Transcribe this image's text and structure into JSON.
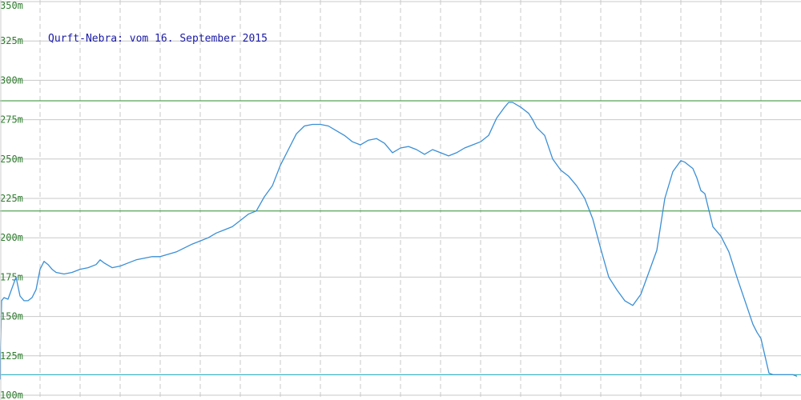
{
  "chart_data": {
    "type": "line",
    "title": "Qurft-Nebra: vom 16. September 2015",
    "ylim": [
      100,
      350
    ],
    "yticks": [
      "100m",
      "125m",
      "150m",
      "175m",
      "200m",
      "225m",
      "250m",
      "275m",
      "300m",
      "325m",
      "350m"
    ],
    "ytick_values": [
      100,
      125,
      150,
      175,
      200,
      225,
      250,
      275,
      300,
      325,
      350
    ],
    "xlim": [
      0,
      100
    ],
    "x_gridlines": [
      5,
      10,
      15,
      20,
      25,
      30,
      35,
      40,
      45,
      50,
      55,
      60,
      65,
      70,
      75,
      80,
      85,
      90,
      95
    ],
    "grid": true,
    "reference_lines": [
      {
        "value": 287,
        "color": "#2e8b2e"
      },
      {
        "value": 217,
        "color": "#2e8b2e"
      },
      {
        "value": 113,
        "color": "#1aa6b7"
      }
    ],
    "series": [
      {
        "color": "#3a8fd6",
        "x": [
          0,
          0.2,
          0.5,
          1.0,
          1.5,
          2.0,
          2.5,
          3.0,
          3.5,
          4.0,
          4.5,
          5.0,
          5.5,
          6.0,
          6.5,
          7.0,
          8.0,
          9.0,
          10.0,
          11.0,
          12.0,
          12.5,
          13.0,
          14.0,
          15.0,
          16.0,
          17.0,
          18.0,
          19.0,
          20.0,
          22.0,
          24.0,
          26.0,
          27.0,
          28.0,
          29.0,
          30.0,
          31.0,
          32.0,
          33.0,
          34.0,
          35.0,
          36.0,
          37.0,
          38.0,
          39.0,
          40.0,
          41.0,
          42.0,
          43.0,
          44.0,
          45.0,
          46.0,
          47.0,
          48.0,
          49.0,
          50.0,
          51.0,
          52.0,
          53.0,
          54.0,
          55.0,
          56.0,
          57.0,
          58.0,
          59.0,
          60.0,
          61.0,
          62.0,
          63.0,
          63.5,
          64.0,
          65.0,
          66.0,
          66.5,
          67.0,
          68.0,
          69.0,
          70.0,
          71.0,
          72.0,
          73.0,
          74.0,
          75.0,
          76.0,
          77.0,
          78.0,
          79.0,
          80.0,
          81.0,
          82.0,
          83.0,
          84.0,
          85.0,
          85.5,
          86.0,
          86.5,
          87.0,
          87.5,
          88.0,
          89.0,
          90.0,
          91.0,
          92.0,
          93.0,
          94.0,
          94.5,
          95.0,
          96.0,
          96.5,
          97.0,
          98.0,
          99.0,
          99.5
        ],
        "values": [
          110,
          160,
          162,
          161,
          168,
          175,
          163,
          160,
          160,
          162,
          167,
          180,
          185,
          183,
          180,
          178,
          177,
          178,
          180,
          181,
          183,
          186,
          184,
          181,
          182,
          184,
          186,
          187,
          188,
          188,
          191,
          196,
          200,
          203,
          205,
          207,
          211,
          215,
          217,
          226,
          233,
          246,
          256,
          266,
          271,
          272,
          272,
          271,
          268,
          265,
          261,
          259,
          262,
          263,
          260,
          254,
          257,
          258,
          256,
          253,
          256,
          254,
          252,
          254,
          257,
          259,
          261,
          265,
          276,
          283,
          286,
          286,
          283,
          279,
          275,
          270,
          265,
          250,
          243,
          239,
          233,
          225,
          212,
          193,
          175,
          167,
          160,
          157,
          164,
          178,
          192,
          225,
          242,
          249,
          248,
          246,
          244,
          238,
          230,
          228,
          207,
          201,
          191,
          175,
          160,
          145,
          140,
          136,
          114,
          113,
          113,
          113,
          113,
          112
        ]
      }
    ]
  }
}
